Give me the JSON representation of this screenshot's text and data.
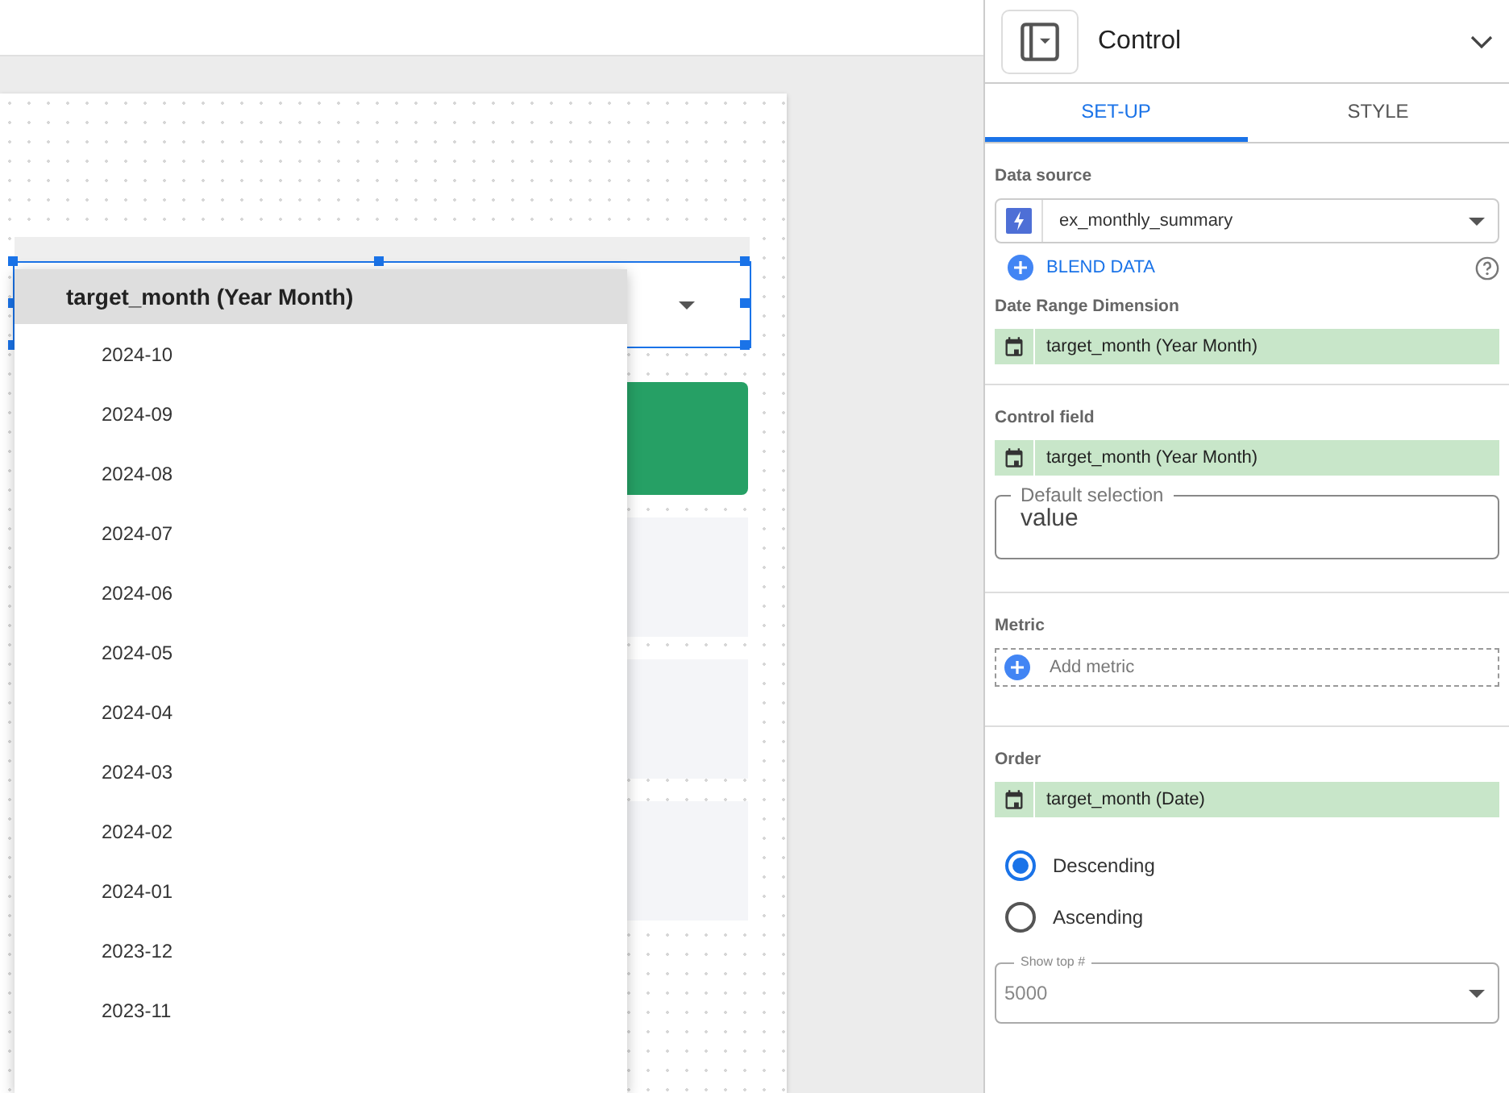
{
  "dropdown": {
    "header": "target_month (Year Month)",
    "options": [
      "2024-10",
      "2024-09",
      "2024-08",
      "2024-07",
      "2024-06",
      "2024-05",
      "2024-04",
      "2024-03",
      "2024-02",
      "2024-01",
      "2023-12",
      "2023-11"
    ]
  },
  "panel": {
    "title": "Control",
    "tabs": [
      {
        "label": "SET-UP",
        "selected": true
      },
      {
        "label": "STYLE",
        "selected": false
      }
    ],
    "data_source": {
      "label": "Data source",
      "value": "ex_monthly_summary",
      "blend": "BLEND DATA"
    },
    "date_range_dimension": {
      "label": "Date Range Dimension",
      "field": "target_month (Year Month)"
    },
    "control_field": {
      "label": "Control field",
      "field": "target_month (Year Month)",
      "default_selection": {
        "label": "Default selection",
        "value": "value"
      }
    },
    "metric": {
      "label": "Metric",
      "add_label": "Add metric"
    },
    "order": {
      "label": "Order",
      "field": "target_month (Date)",
      "options": [
        {
          "label": "Descending",
          "selected": true
        },
        {
          "label": "Ascending",
          "selected": false
        }
      ],
      "show_top": {
        "label": "Show top #",
        "placeholder": "5000"
      }
    }
  }
}
